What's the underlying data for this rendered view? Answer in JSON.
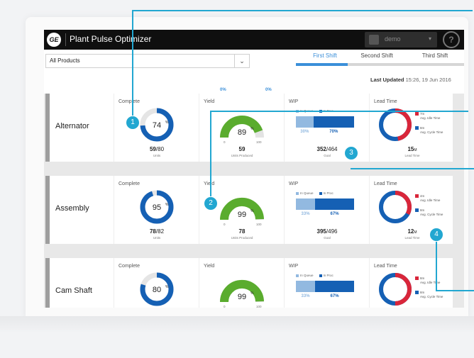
{
  "app": {
    "title": "Plant Pulse Optimizer",
    "logo": "GE",
    "user": "demo",
    "help": "?"
  },
  "filter": {
    "product": "All Products"
  },
  "tabs": [
    {
      "label": "First Shift",
      "active": true
    },
    {
      "label": "Second Shift",
      "active": false
    },
    {
      "label": "Third Shift",
      "active": false
    }
  ],
  "last_updated": {
    "label": "Last Updated",
    "value": "15:26, 19 Jun 2016"
  },
  "summary_pcts": [
    "0%",
    "0%"
  ],
  "columns": [
    "Complete",
    "Yield",
    "WIP",
    "Lead Time"
  ],
  "rows": [
    {
      "name": "Alternator",
      "complete": {
        "pct_label": "74",
        "done": "59",
        "total": "/80",
        "units": "Units",
        "fraction": 0.74
      },
      "yield": {
        "pct_label": "89",
        "produced": "59",
        "label": "Units Produced",
        "min": "0",
        "max": "100",
        "fraction": 0.89
      },
      "wip": {
        "legend_queue": "In Queue",
        "legend_process": "In Proc",
        "queue_pct": "30%",
        "process_pct": "70%",
        "queue_fraction": 0.3,
        "value": "352",
        "total": "/464",
        "goal": "Goal"
      },
      "lead": {
        "red": "7m",
        "red_label": "Avg. Idle Time",
        "blue": "8m",
        "blue_label": "Avg. Cycle Time",
        "total": "15",
        "unit": "M",
        "label": "Lead Time",
        "red_fraction": 0.47
      }
    },
    {
      "name": "Assembly",
      "complete": {
        "pct_label": "95",
        "done": "78",
        "total": "/82",
        "units": "Units",
        "fraction": 0.95
      },
      "yield": {
        "pct_label": "99",
        "produced": "78",
        "label": "Units Produced",
        "min": "0",
        "max": "100",
        "fraction": 0.99
      },
      "wip": {
        "legend_queue": "In Queue",
        "legend_process": "In Proc",
        "queue_pct": "33%",
        "process_pct": "67%",
        "queue_fraction": 0.33,
        "value": "395",
        "total": "/496",
        "goal": "Goal"
      },
      "lead": {
        "red": "4m",
        "red_label": "Avg. Idle Time",
        "blue": "8m",
        "blue_label": "Avg. Cycle Time",
        "total": "12",
        "unit": "M",
        "label": "Lead Time",
        "red_fraction": 0.33
      }
    },
    {
      "name": "Cam Shaft",
      "complete": {
        "pct_label": "80",
        "done": "",
        "total": "",
        "units": "",
        "fraction": 0.8
      },
      "yield": {
        "pct_label": "99",
        "produced": "",
        "label": "",
        "min": "0",
        "max": "100",
        "fraction": 0.99
      },
      "wip": {
        "legend_queue": "In Queue",
        "legend_process": "In Proc",
        "queue_pct": "33%",
        "process_pct": "67%",
        "queue_fraction": 0.33,
        "value": "",
        "total": "",
        "goal": ""
      },
      "lead": {
        "red": "8m",
        "red_label": "Avg. Idle Time",
        "blue": "8m",
        "blue_label": "Avg. Cycle Time",
        "total": "",
        "unit": "",
        "label": "",
        "red_fraction": 0.5
      }
    }
  ],
  "callouts": [
    "1",
    "2",
    "3",
    "4"
  ],
  "colors": {
    "blue": "#1560b4",
    "light_blue": "#92b9e0",
    "green": "#5aac2e",
    "red": "#d9263a",
    "accent": "#3b8fd9",
    "callout": "#22a7d1"
  }
}
